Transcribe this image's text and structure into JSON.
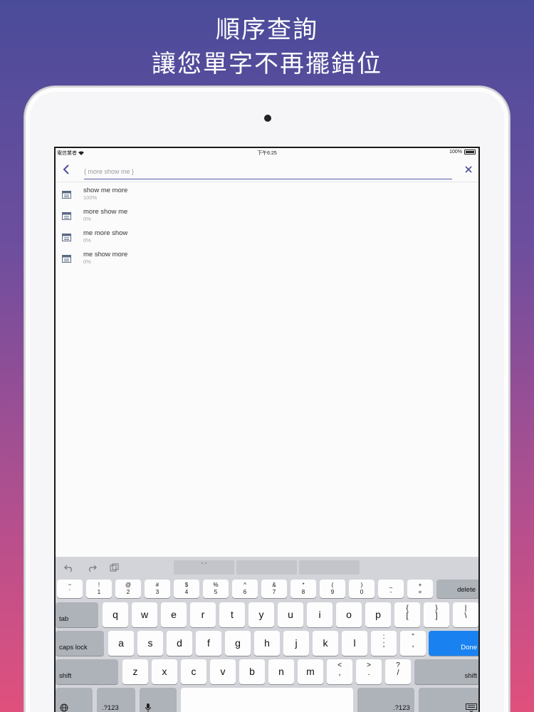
{
  "headline": {
    "line1": "順序查詢",
    "line2": "讓您單字不再擺錯位"
  },
  "status": {
    "carrier": "電信業者",
    "time": "下午6:25",
    "battery": "100%"
  },
  "search": {
    "value": "{ more show me }"
  },
  "results": [
    {
      "title": "show me more",
      "percent": "100%"
    },
    {
      "title": "more show me",
      "percent": "0%"
    },
    {
      "title": "me more show",
      "percent": "0%"
    },
    {
      "title": "me show more",
      "percent": "0%"
    }
  ],
  "keyboard": {
    "suggestion_1": "\" \"",
    "row1": [
      {
        "top": "~",
        "bot": "`"
      },
      {
        "top": "!",
        "bot": "1"
      },
      {
        "top": "@",
        "bot": "2"
      },
      {
        "top": "#",
        "bot": "3"
      },
      {
        "top": "$",
        "bot": "4"
      },
      {
        "top": "%",
        "bot": "5"
      },
      {
        "top": "^",
        "bot": "6"
      },
      {
        "top": "&",
        "bot": "7"
      },
      {
        "top": "*",
        "bot": "8"
      },
      {
        "top": "(",
        "bot": "9"
      },
      {
        "top": ")",
        "bot": "0"
      },
      {
        "top": "_",
        "bot": "-"
      },
      {
        "top": "+",
        "bot": "="
      }
    ],
    "delete": "delete",
    "tab": "tab",
    "row2": [
      "q",
      "w",
      "e",
      "r",
      "t",
      "y",
      "u",
      "i",
      "o",
      "p"
    ],
    "row2_sym": [
      {
        "top": "{",
        "bot": "["
      },
      {
        "top": "}",
        "bot": "]"
      },
      {
        "top": "|",
        "bot": "\\"
      }
    ],
    "caps": "caps lock",
    "row3": [
      "a",
      "s",
      "d",
      "f",
      "g",
      "h",
      "j",
      "k",
      "l"
    ],
    "row3_sym": [
      {
        "top": ":",
        "bot": ";"
      },
      {
        "top": "”",
        "bot": ","
      }
    ],
    "done": "Done",
    "shift": "shift",
    "row4": [
      "z",
      "x",
      "c",
      "v",
      "b",
      "n",
      "m"
    ],
    "row4_sym": [
      {
        "top": "<",
        "bot": ","
      },
      {
        "top": ">",
        "bot": "."
      },
      {
        "top": "?",
        "bot": "/"
      }
    ],
    "num_left": ".?123",
    "num_right": ".?123",
    "accent_color": "#1a82f0"
  }
}
